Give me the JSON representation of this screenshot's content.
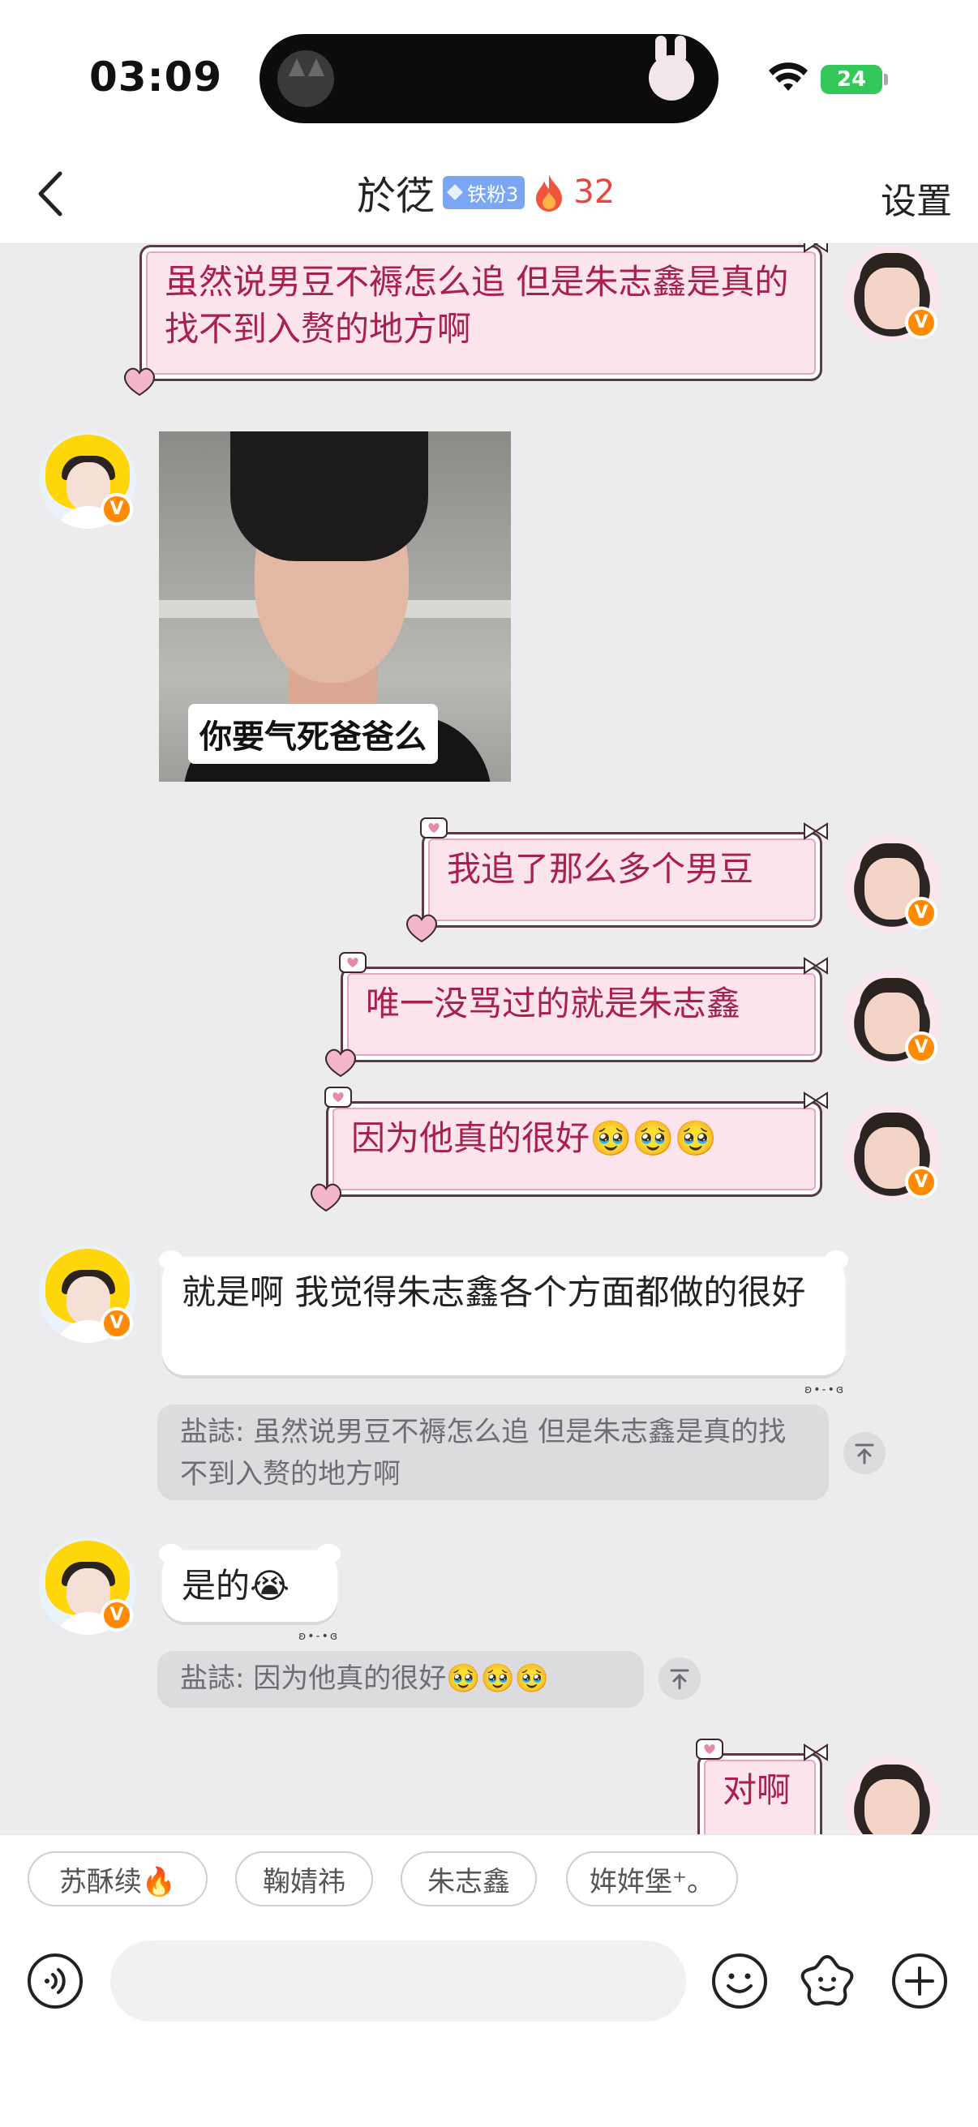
{
  "status_bar": {
    "time": "03:09",
    "battery": "24"
  },
  "header": {
    "title": "於徔",
    "fan_badge": "铁粉3",
    "streak": "32",
    "settings_label": "设置"
  },
  "messages": {
    "m1": {
      "text": "虽然说男豆不褥怎么追 但是朱志鑫是真的找不到入赘的地方啊"
    },
    "m2": {
      "caption": "你要气死爸爸么"
    },
    "m3": {
      "text": "我追了那么多个男豆"
    },
    "m4": {
      "text": "唯一没骂过的就是朱志鑫"
    },
    "m5": {
      "text": "因为他真的很好🥹🥹🥹"
    },
    "m6": {
      "text": "就是啊 我觉得朱志鑫各个方面都做的很好",
      "quote": "盐誌: 虽然说男豆不褥怎么追 但是朱志鑫是真的找不到入赘的地方啊"
    },
    "m7": {
      "text": "是的😭",
      "quote": "盐誌: 因为他真的很好🥹🥹🥹"
    },
    "m8": {
      "text": "对啊"
    }
  },
  "quick_replies": [
    "苏酥续🔥",
    "鞠婧祎",
    "朱志鑫",
    "姩姩堡⁺。"
  ],
  "colors": {
    "accent": "#e8453c",
    "verified_badge": "#ff8a00",
    "pink_bubble_text": "#a8214d",
    "fan_badge": "#7aa6f3"
  },
  "icons": [
    "back-icon",
    "flame-icon",
    "wifi-icon",
    "voice-icon",
    "emoji-icon",
    "sticker-icon",
    "plus-icon",
    "pin-top-icon"
  ]
}
